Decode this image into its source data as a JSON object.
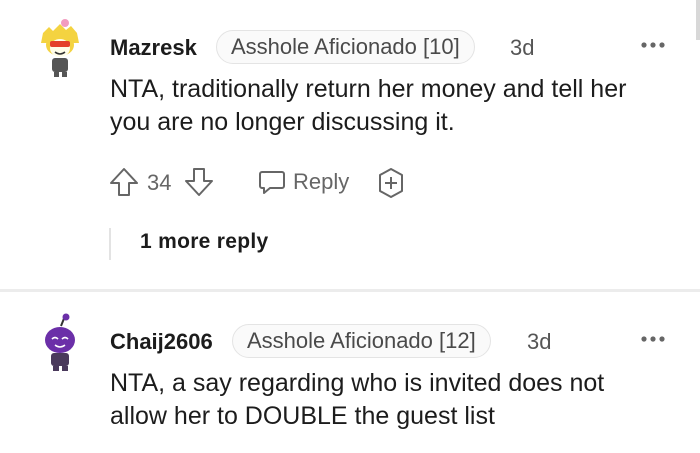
{
  "comments": [
    {
      "username": "Mazresk",
      "flair": "Asshole Aficionado [10]",
      "age": "3d",
      "body_line1": "NTA, traditionally return her money and tell her",
      "body_line2": "you are no longer discussing it.",
      "vote_count": "34",
      "reply_label": "Reply",
      "more_replies": "1 more reply"
    },
    {
      "username": "Chaij2606",
      "flair": "Asshole Aficionado [12]",
      "age": "3d",
      "body_line1": "NTA, a say regarding who is invited does not",
      "body_line2": "allow her to DOUBLE the guest list"
    }
  ]
}
